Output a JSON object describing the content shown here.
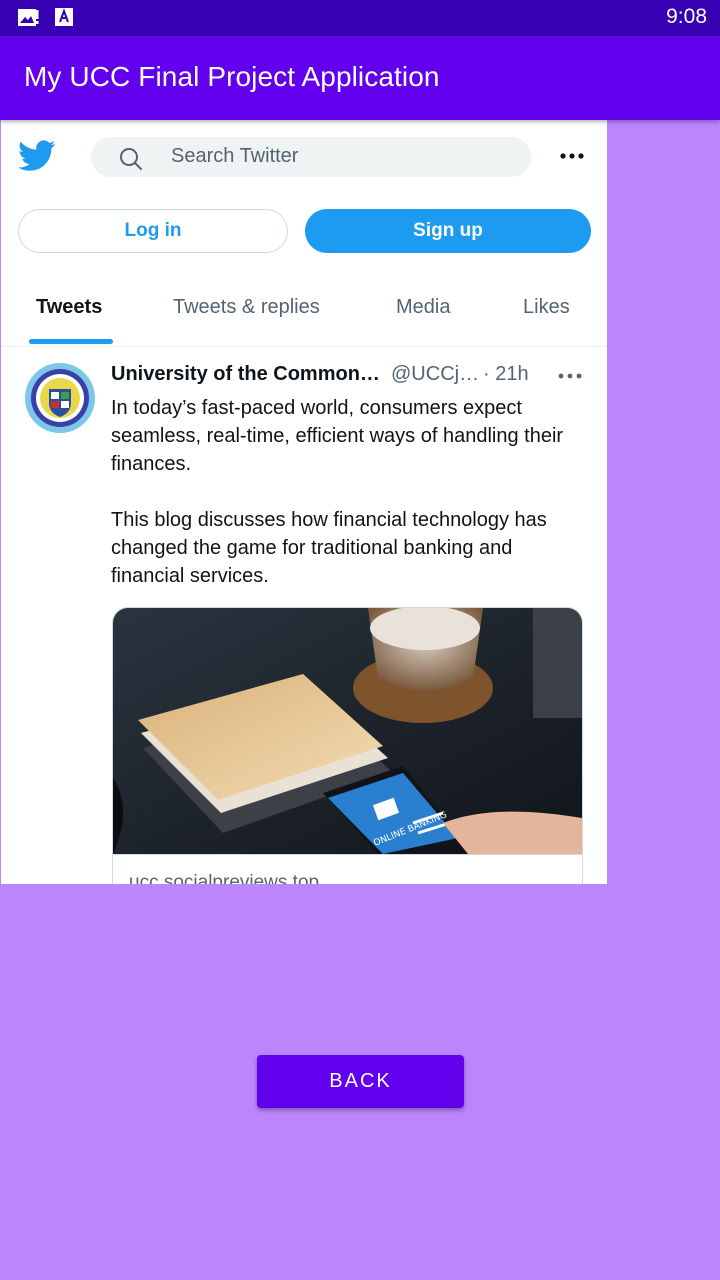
{
  "status_bar": {
    "time": "9:08",
    "icons": [
      "image-notification-icon",
      "font-app-icon"
    ]
  },
  "app_bar": {
    "title": "My UCC Final Project Application"
  },
  "webview": {
    "search": {
      "placeholder": "Search Twitter",
      "icon": "search-icon"
    },
    "buttons": {
      "login": "Log in",
      "signup": "Sign up"
    },
    "tabs": [
      {
        "label": "Tweets",
        "active": true
      },
      {
        "label": "Tweets & replies",
        "active": false
      },
      {
        "label": "Media",
        "active": false
      },
      {
        "label": "Likes",
        "active": false
      }
    ],
    "tweet": {
      "author": "University of the Common…",
      "handle": "@UCCj…",
      "time": "· 21h",
      "paragraphs": [
        "In today’s fast-paced world, consumers expect seamless, real-time, efficient ways of handling their finances.",
        "This blog discusses how financial technology has changed the game for traditional banking and financial services."
      ],
      "card": {
        "domain": "ucc.socialpreviews.top",
        "image_text": "ONLINE BANKING"
      }
    }
  },
  "back_button": {
    "label": "BACK"
  },
  "colors": {
    "primary": "#6200ee",
    "primary_dark": "#3700b3",
    "background": "#bb86fc",
    "twitter_blue": "#1d9bf0"
  }
}
